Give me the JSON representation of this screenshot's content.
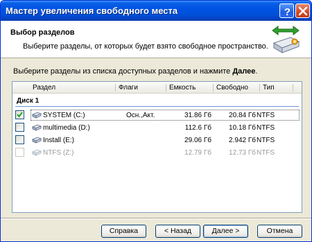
{
  "window": {
    "title": "Мастер увеличения свободного места"
  },
  "header": {
    "title": "Выбор разделов",
    "description": "Выберите разделы, от которых будет взято свободное пространство."
  },
  "instruction": {
    "prefix": "Выберите разделы из списка доступных разделов и нажмите ",
    "bold": "Далее",
    "suffix": "."
  },
  "list": {
    "columns": [
      "Раздел",
      "Флаги",
      "Емкость",
      "Свободно",
      "Тип"
    ],
    "group": "Диск 1",
    "rows": [
      {
        "name": "SYSTEM (C:)",
        "flags": "Осн.,Акт.",
        "capacity": "31.86 Гб",
        "free": "20.84 Гб",
        "type": "NTFS",
        "checked": true,
        "enabled": true
      },
      {
        "name": "multimedia (D:)",
        "flags": "",
        "capacity": "112.6 Гб",
        "free": "10.18 Гб",
        "type": "NTFS",
        "checked": false,
        "enabled": true
      },
      {
        "name": "Install (E:)",
        "flags": "",
        "capacity": "29.06 Гб",
        "free": "2.942 Гб",
        "type": "NTFS",
        "checked": false,
        "enabled": true
      },
      {
        "name": "NTFS (Z:)",
        "flags": "",
        "capacity": "12.79 Гб",
        "free": "12.73 Гб",
        "type": "NTFS",
        "checked": false,
        "enabled": false
      }
    ]
  },
  "buttons": {
    "help": "Справка",
    "back": "< Назад",
    "next": "Далее >",
    "cancel": "Отмена"
  },
  "icons": {
    "help": "help-icon",
    "close": "close-icon",
    "wizard": "disk-resize-icon",
    "drive": "drive-icon",
    "check": "checkmark-icon"
  },
  "colors": {
    "titlebar": "#0054e3",
    "close": "#d24a25",
    "check": "#21a121"
  }
}
